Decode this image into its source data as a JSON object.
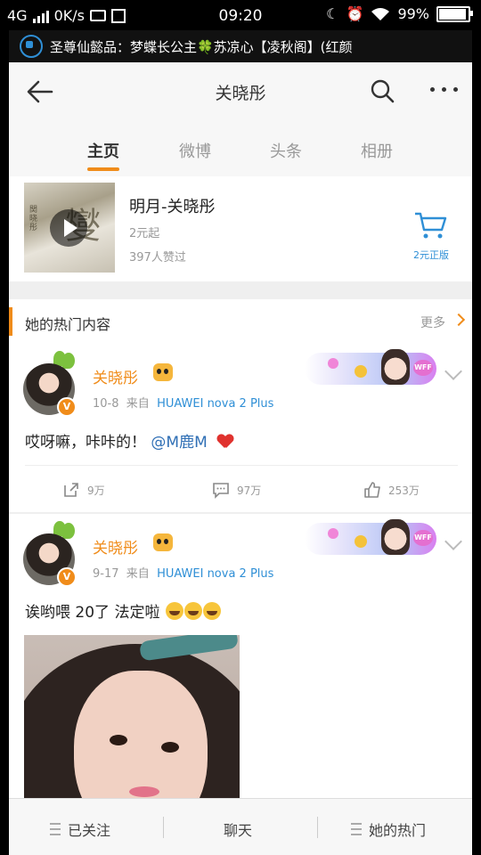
{
  "status_bar": {
    "network": "4G",
    "speed": "0K/s",
    "time": "09:20",
    "battery": "99%",
    "battery_level": 0.99
  },
  "ticker": {
    "text": "圣尊仙懿品：梦蝶长公主🍀苏凉心【凌秋阁】(红颜"
  },
  "nav": {
    "title": "关晓彤",
    "back_icon": "arrow-left-icon",
    "search_icon": "search-icon",
    "more_icon": "more-dots-icon"
  },
  "tabs": [
    {
      "label": "主页",
      "active": true
    },
    {
      "label": "微博",
      "active": false
    },
    {
      "label": "头条",
      "active": false
    },
    {
      "label": "相册",
      "active": false
    }
  ],
  "product": {
    "title": "明月-关晓彤",
    "price": "2元起",
    "likes": "397人赞过",
    "cart_label": "2元正版",
    "thumb_side_text": "関晓彤",
    "thumb_glyph": "燮"
  },
  "section": {
    "title": "她的热门内容",
    "more": "更多"
  },
  "posts": [
    {
      "username": "关晓彤",
      "date": "10-8",
      "from_label": "来自",
      "device": "HUAWEI nova 2 Plus",
      "text_before": "哎呀嘛，咔咔的！",
      "mention": "@M鹿M",
      "reposts": "9万",
      "comments": "97万",
      "likes": "253万",
      "badge": "V",
      "card_label": "WFF"
    },
    {
      "username": "关晓彤",
      "date": "9-17",
      "from_label": "来自",
      "device": "HUAWEI nova 2 Plus",
      "text": "诶哟喂 20了 法定啦",
      "badge": "V",
      "card_label": "WFF"
    }
  ],
  "bottom_bar": {
    "followed": "已关注",
    "chat": "聊天",
    "hot": "她的热门"
  },
  "colors": {
    "accent": "#f08c1a",
    "link": "#2f8fd6",
    "mention": "#2f6fb5"
  }
}
